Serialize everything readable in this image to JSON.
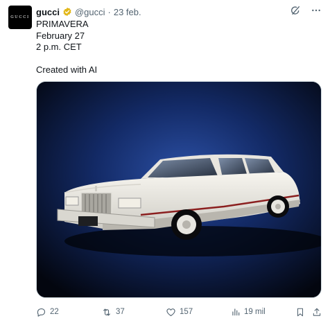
{
  "author": {
    "avatar_text": "GUCCI",
    "name": "gucci",
    "handle": "@gucci",
    "separator": "·",
    "date": "23 feb.",
    "verified_color": "#e2b719"
  },
  "icons": {
    "grok": "grok-icon",
    "more": "more-icon",
    "reply": "reply-icon",
    "repost": "repost-icon",
    "like": "like-icon",
    "views": "views-icon",
    "bookmark": "bookmark-icon",
    "share": "share-icon"
  },
  "tweet": {
    "lines": [
      "PRIMAVERA",
      "February 27",
      "2 p.m. CET",
      "",
      "Created with AI"
    ]
  },
  "media": {
    "description_for_alt": "White vintage sedan on dark blue backdrop"
  },
  "actions": {
    "replies": "22",
    "reposts": "37",
    "likes": "157",
    "views": "19 mil"
  },
  "colors": {
    "text": "#0f1419",
    "muted": "#536471"
  }
}
